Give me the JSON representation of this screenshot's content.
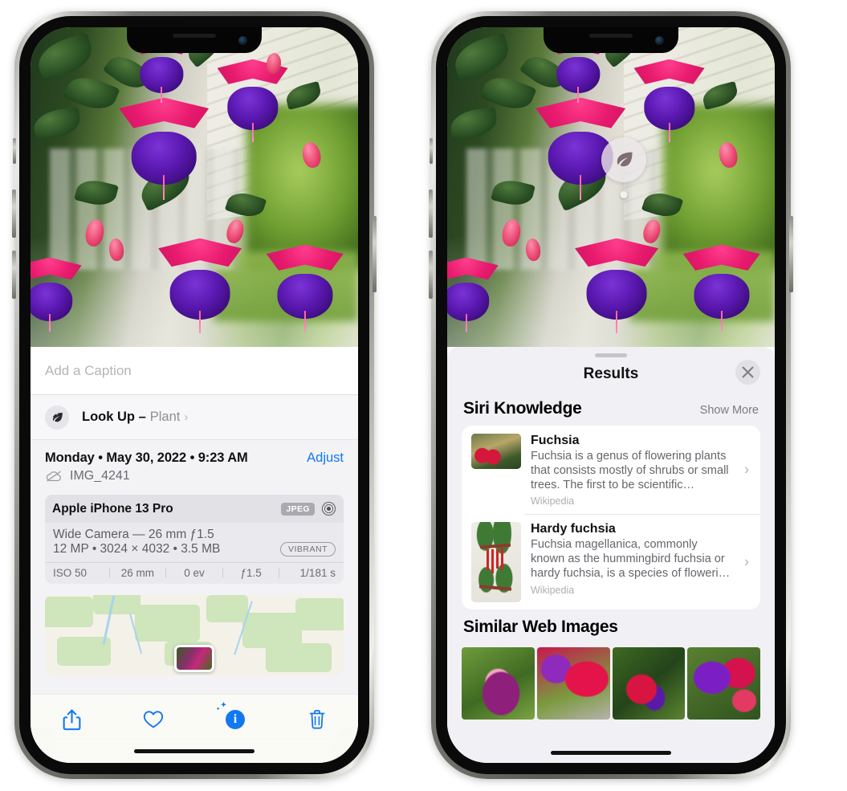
{
  "left_phone": {
    "name": "photos-detail-screen",
    "caption": {
      "placeholder": "Add a Caption",
      "value": ""
    },
    "lookup": {
      "label": "Look Up –",
      "subject": "Plant",
      "chevron": "›",
      "icon": "leaf-icon"
    },
    "info": {
      "date": "Monday • May 30, 2022 • 9:23 AM",
      "adjust": "Adjust",
      "filename": "IMG_4241",
      "cloud_icon": "cloud-slash-icon"
    },
    "camera": {
      "model": "Apple iPhone 13 Pro",
      "format_tag": "JPEG",
      "raw_icon": "aperture-icon",
      "lens": "Wide Camera — 26 mm ƒ1.5",
      "specs": "12 MP • 3024 × 4032 • 3.5 MB",
      "style_tag": "VIBRANT",
      "exif": [
        "ISO 50",
        "26 mm",
        "0 ev",
        "ƒ1.5",
        "1/181 s"
      ]
    },
    "toolbar": [
      {
        "name": "share-button",
        "icon": "share-icon"
      },
      {
        "name": "favorite-button",
        "icon": "heart-icon"
      },
      {
        "name": "info-button",
        "icon": "info-sparkle-icon",
        "label": "i"
      },
      {
        "name": "delete-button",
        "icon": "trash-icon"
      }
    ]
  },
  "right_phone": {
    "name": "visual-lookup-results-screen",
    "badge": {
      "icon": "leaf-icon"
    },
    "sheet": {
      "title": "Results",
      "close_icon": "close-icon"
    },
    "siri_knowledge": {
      "title": "Siri Knowledge",
      "action": "Show More",
      "items": [
        {
          "title": "Fuchsia",
          "desc": "Fuchsia is a genus of flowering plants that consists mostly of shrubs or small trees. The first to be scientific…",
          "source": "Wikipedia",
          "thumb": "fuchsia-red-flowers-thumb",
          "chevron": "›"
        },
        {
          "title": "Hardy fuchsia",
          "desc": "Fuchsia magellanica, commonly known as the hummingbird fuchsia or hardy fuchsia, is a species of floweri…",
          "source": "Wikipedia",
          "thumb": "hardy-fuchsia-specimen-thumb",
          "chevron": "›"
        }
      ]
    },
    "similar_web_images": {
      "title": "Similar Web Images",
      "items": [
        {
          "name": "similar-image-1",
          "alt": "pink and magenta fuchsia with green leaves"
        },
        {
          "name": "similar-image-2",
          "alt": "red fuchsia blossoms close-up"
        },
        {
          "name": "similar-image-3",
          "alt": "fuchsia bush with red and purple flowers"
        },
        {
          "name": "similar-image-4",
          "alt": "purple and red fuchsia cluster"
        }
      ]
    }
  },
  "colors": {
    "accent_blue": "#1178f0",
    "sheet_gray": "#f1f1f5",
    "card_white": "#ffffff",
    "secondary_text": "#8e8e93"
  }
}
